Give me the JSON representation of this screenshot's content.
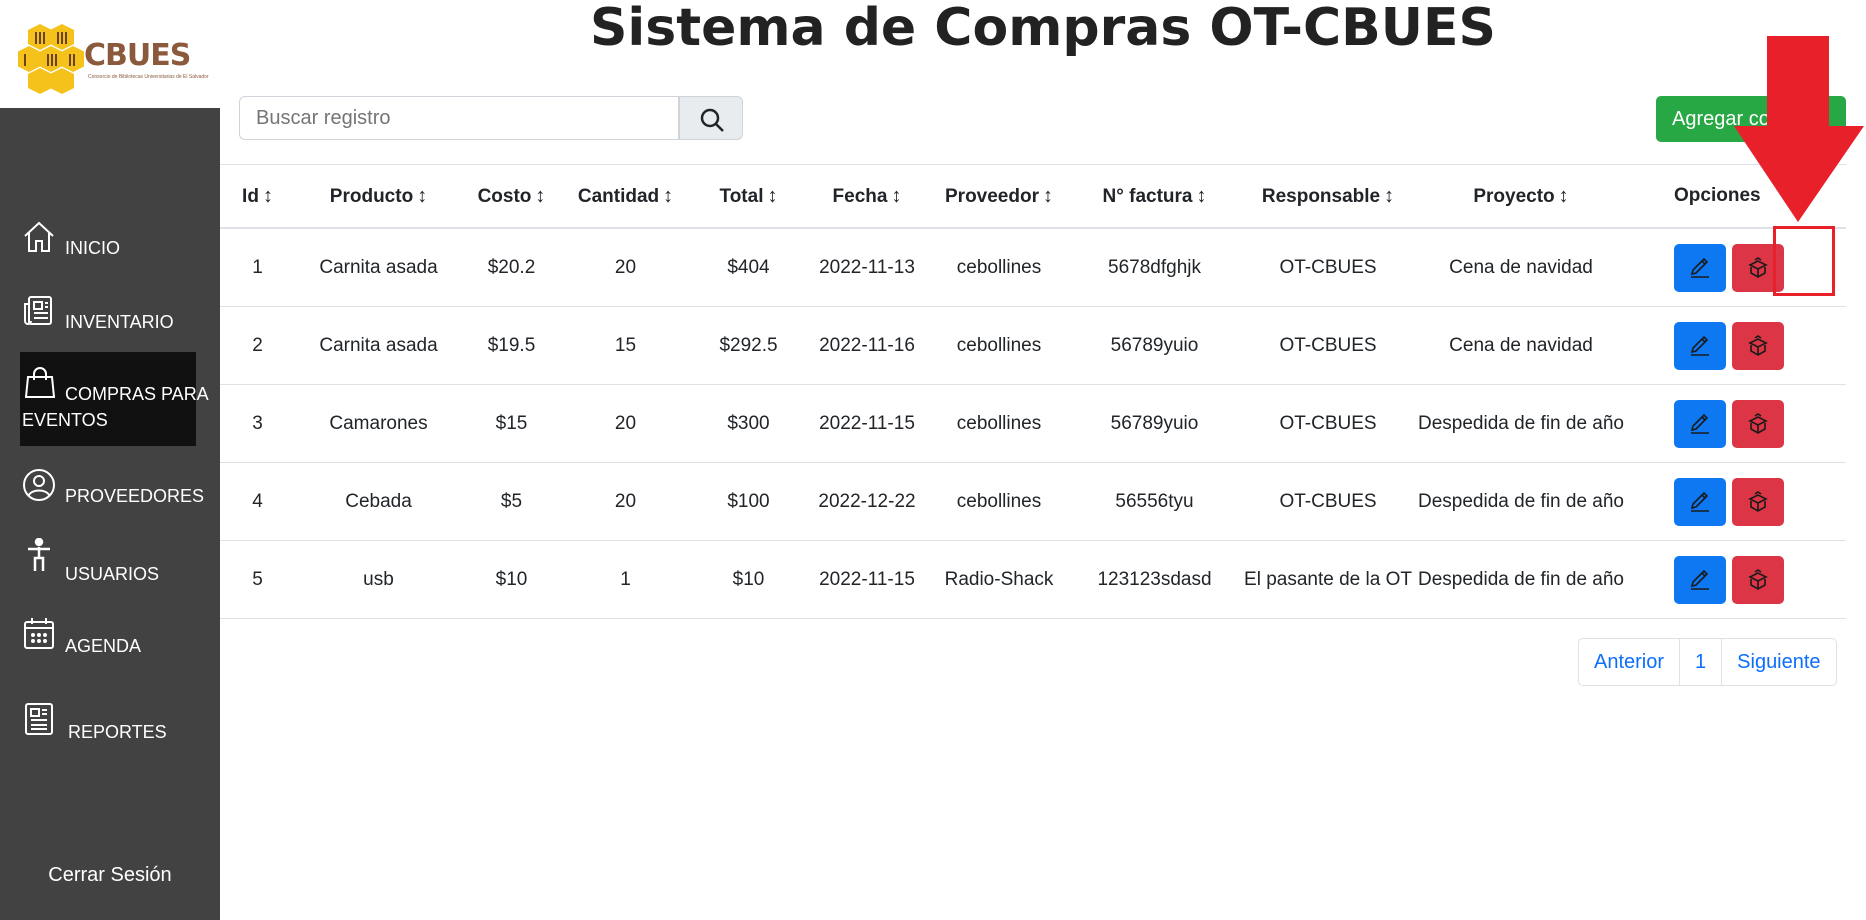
{
  "logo": {
    "text": "CBUES",
    "subtitle": "Consorcio de Bibliotecas Universitarias de El Salvador"
  },
  "page_title": "Sistema de Compras OT-CBUES",
  "search": {
    "placeholder": "Buscar registro"
  },
  "add_button": "Agregar compra",
  "sidebar": {
    "items": [
      {
        "label": "INICIO",
        "icon": "home-icon"
      },
      {
        "label": "INVENTARIO",
        "icon": "newspaper-icon"
      },
      {
        "label": "COMPRAS PARA",
        "label2": "EVENTOS",
        "icon": "shopping-bag-icon",
        "active": true
      },
      {
        "label": "PROVEEDORES",
        "icon": "user-circle-icon"
      },
      {
        "label": "USUARIOS",
        "icon": "person-standing-icon"
      },
      {
        "label": "AGENDA",
        "icon": "calendar-icon"
      },
      {
        "label": "REPORTES",
        "icon": "report-icon"
      }
    ],
    "logout": "Cerrar Sesión"
  },
  "table": {
    "headers": [
      "Id",
      "Producto",
      "Costo",
      "Cantidad",
      "Total",
      "Fecha",
      "Proveedor",
      "N° factura",
      "Responsable",
      "Proyecto",
      "Opciones"
    ],
    "rows": [
      [
        "1",
        "Carnita asada",
        "$20.2",
        "20",
        "$404",
        "2022-11-13",
        "cebollines",
        "5678dfghjk",
        "OT-CBUES",
        "Cena de navidad"
      ],
      [
        "2",
        "Carnita asada",
        "$19.5",
        "15",
        "$292.5",
        "2022-11-16",
        "cebollines",
        "56789yuio",
        "OT-CBUES",
        "Cena de navidad"
      ],
      [
        "3",
        "Camarones",
        "$15",
        "20",
        "$300",
        "2022-11-15",
        "cebollines",
        "56789yuio",
        "OT-CBUES",
        "Despedida de fin de año"
      ],
      [
        "4",
        "Cebada",
        "$5",
        "20",
        "$100",
        "2022-12-22",
        "cebollines",
        "56556tyu",
        "OT-CBUES",
        "Despedida de fin de año"
      ],
      [
        "5",
        "usb",
        "$10",
        "1",
        "$10",
        "2022-11-15",
        "Radio-Shack",
        "123123sdasd",
        "El pasante de la OT",
        "Despedida de fin de año"
      ]
    ]
  },
  "pagination": {
    "prev": "Anterior",
    "page": "1",
    "next": "Siguiente"
  },
  "colors": {
    "sidebar": "#424242",
    "active": "#111111",
    "edit": "#0d78f2",
    "delete": "#dc3545",
    "add": "#28a745",
    "annotation": "#e8202a"
  }
}
